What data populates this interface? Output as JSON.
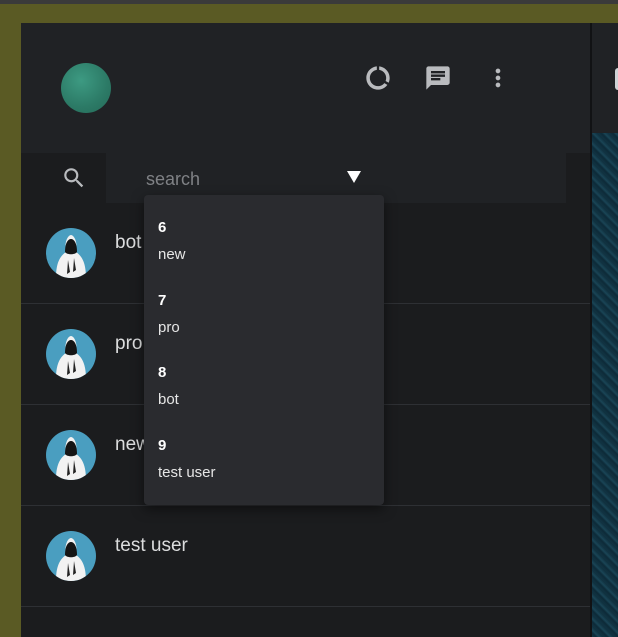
{
  "search": {
    "placeholder": "search"
  },
  "header_icons": [
    "status-icon",
    "new-chat-icon",
    "menu-icon"
  ],
  "chats": [
    {
      "name": "bot"
    },
    {
      "name": "pro"
    },
    {
      "name": "new"
    },
    {
      "name": "test user"
    }
  ],
  "dropdown": {
    "options": [
      {
        "id": "6",
        "label": "new"
      },
      {
        "id": "7",
        "label": "pro"
      },
      {
        "id": "8",
        "label": "bot"
      },
      {
        "id": "9",
        "label": "test user"
      }
    ]
  },
  "colors": {
    "accent_avatar": "#2c7a66",
    "chat_avatar_bg": "#4a9ec0"
  }
}
